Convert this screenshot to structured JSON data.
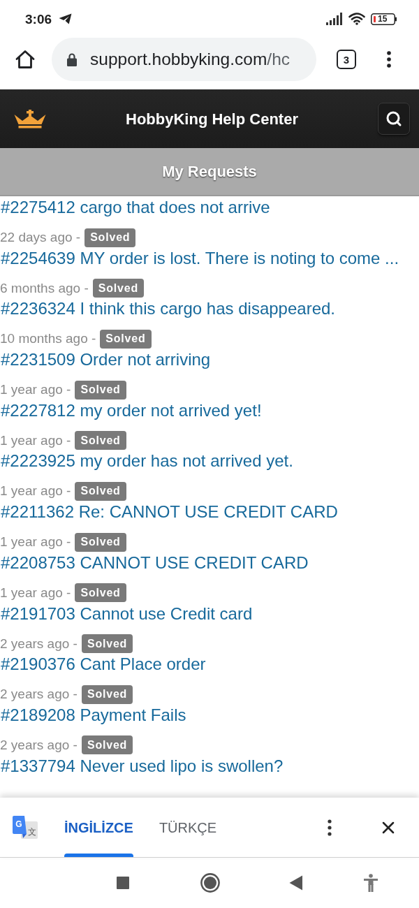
{
  "status_bar": {
    "time": "3:06",
    "battery": "15"
  },
  "browser": {
    "url_host": "support.hobbyking.com",
    "url_path": "/hc",
    "tab_count": "3"
  },
  "header": {
    "title": "HobbyKing Help Center"
  },
  "section": {
    "title": "My Requests"
  },
  "requests": [
    {
      "title": "#2275412 cargo that does not arrive",
      "age": "22 days ago -",
      "status": "Solved"
    },
    {
      "title": "#2254639 MY order is lost. There is noting to come ...",
      "age": "6 months ago -",
      "status": "Solved"
    },
    {
      "title": "#2236324 I think this cargo has disappeared.",
      "age": "10 months ago -",
      "status": "Solved"
    },
    {
      "title": "#2231509 Order not arriving",
      "age": "1 year ago -",
      "status": "Solved"
    },
    {
      "title": "#2227812 my order not arrived yet!",
      "age": "1 year ago -",
      "status": "Solved"
    },
    {
      "title": "#2223925 my order has not arrived yet.",
      "age": "1 year ago -",
      "status": "Solved"
    },
    {
      "title": "#2211362 Re: CANNOT USE CREDIT CARD",
      "age": "1 year ago -",
      "status": "Solved"
    },
    {
      "title": "#2208753 CANNOT USE CREDIT CARD",
      "age": "1 year ago -",
      "status": "Solved"
    },
    {
      "title": "#2191703 Cannot use Credit card",
      "age": "2 years ago -",
      "status": "Solved"
    },
    {
      "title": "#2190376 Cant Place order",
      "age": "2 years ago -",
      "status": "Solved"
    },
    {
      "title": "#2189208 Payment Fails",
      "age": "2 years ago -",
      "status": "Solved"
    },
    {
      "title": "#1337794 Never used lipo is swollen?"
    }
  ],
  "translate_bar": {
    "logo_letter": "G",
    "logo_symbol": "文",
    "languages": [
      {
        "label": "İNGİLİZCE",
        "selected": true
      },
      {
        "label": "TÜRKÇE",
        "selected": false
      }
    ]
  }
}
